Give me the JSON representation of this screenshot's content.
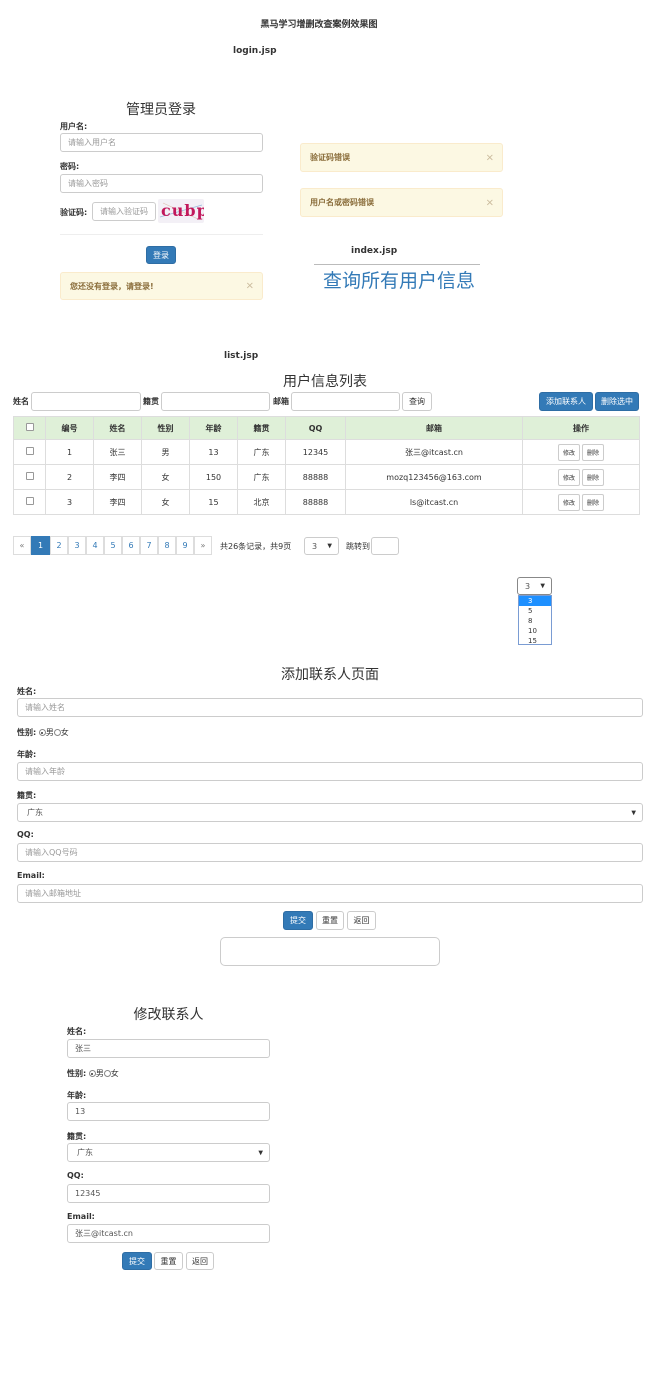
{
  "page_title": "黑马学习增删改查案例效果图",
  "login": {
    "file_label": "login.jsp",
    "title": "管理员登录",
    "username_label": "用户名:",
    "username_placeholder": "请输入用户名",
    "password_label": "密码:",
    "password_placeholder": "请输入密码",
    "captcha_label": "验证码:",
    "captcha_placeholder": "请输入验证码",
    "captcha_text": "cubp",
    "login_button": "登录",
    "alert_not_logged": "您还没有登录，请登录!",
    "alert_captcha_error": "验证码错误",
    "alert_credentials_error": "用户名或密码错误"
  },
  "index": {
    "file_label": "index.jsp",
    "link_text": "查询所有用户信息"
  },
  "list": {
    "file_label": "list.jsp",
    "title": "用户信息列表",
    "search": {
      "name_label": "姓名",
      "origin_label": "籍贯",
      "email_label": "邮箱",
      "query_button": "查询"
    },
    "add_button": "添加联系人",
    "delete_selected_button": "删除选中",
    "columns": [
      "编号",
      "姓名",
      "性别",
      "年龄",
      "籍贯",
      "QQ",
      "邮箱",
      "操作"
    ],
    "rows": [
      {
        "id": "1",
        "name": "张三",
        "gender": "男",
        "age": "13",
        "origin": "广东",
        "qq": "12345",
        "email": "张三@itcast.cn"
      },
      {
        "id": "2",
        "name": "李四",
        "gender": "女",
        "age": "150",
        "origin": "广东",
        "qq": "88888",
        "email": "mozq123456@163.com"
      },
      {
        "id": "3",
        "name": "李四",
        "gender": "女",
        "age": "15",
        "origin": "北京",
        "qq": "88888",
        "email": "ls@itcast.cn"
      }
    ],
    "row_actions": {
      "edit": "修改",
      "delete": "删除"
    },
    "pagination": {
      "prev": "«",
      "next": "»",
      "pages": [
        "1",
        "2",
        "3",
        "4",
        "5",
        "6",
        "7",
        "8",
        "9"
      ],
      "current": "1",
      "summary": "共26条记录，共9页",
      "page_size": "3",
      "jump_label": "跳转到"
    },
    "page_size_dropdown": {
      "selected": "3",
      "options": [
        "3",
        "5",
        "8",
        "10",
        "15"
      ]
    }
  },
  "add_form": {
    "title": "添加联系人页面",
    "name_label": "姓名:",
    "name_placeholder": "请输入姓名",
    "gender_label": "性别:",
    "gender_male": "男",
    "gender_female": "女",
    "age_label": "年龄:",
    "age_placeholder": "请输入年龄",
    "origin_label": "籍贯:",
    "origin_value": "广东",
    "qq_label": "QQ:",
    "qq_placeholder": "请输入QQ号码",
    "email_label": "Email:",
    "email_placeholder": "请输入邮箱地址",
    "submit": "提交",
    "reset": "重置",
    "back": "返回"
  },
  "edit_form": {
    "title": "修改联系人",
    "name_label": "姓名:",
    "name_value": "张三",
    "gender_label": "性别:",
    "gender_male": "男",
    "gender_female": "女",
    "age_label": "年龄:",
    "age_value": "13",
    "origin_label": "籍贯:",
    "origin_value": "广东",
    "qq_label": "QQ:",
    "qq_value": "12345",
    "email_label": "Email:",
    "email_value": "张三@itcast.cn",
    "submit": "提交",
    "reset": "重置",
    "back": "返回"
  },
  "colors": {
    "primary": "#337ab7",
    "alert_bg": "#fcf8e3",
    "alert_text": "#8a6d3b",
    "table_header_bg": "#dff0d8"
  }
}
